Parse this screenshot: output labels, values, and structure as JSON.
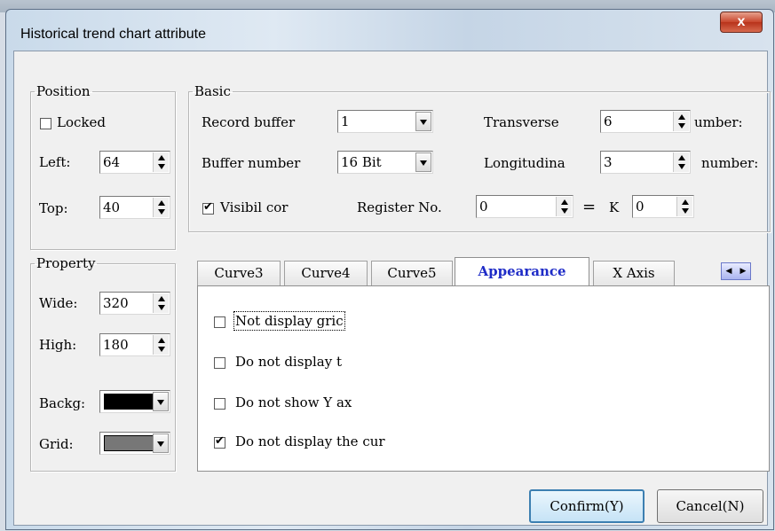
{
  "window": {
    "title": "Historical trend chart attribute",
    "close_label": "x"
  },
  "position": {
    "legend": "Position",
    "locked_label": "Locked",
    "locked_checked": false,
    "left_label": "Left:",
    "left_value": "64",
    "top_label": "Top:",
    "top_value": "40"
  },
  "basic": {
    "legend": "Basic",
    "record_buffer_label": "Record buffer",
    "record_buffer_value": "1",
    "buffer_number_label": "Buffer number",
    "buffer_number_value": "16 Bit",
    "transverse_label": "Transverse",
    "transverse_value": "6",
    "transverse_suffix": "umber:",
    "longitudinal_label": "Longitudina",
    "longitudinal_value": "3",
    "longitudinal_suffix": "number:",
    "visibility_label": "Visibil cor",
    "visibility_checked": true,
    "register_label": "Register No.",
    "register_value": "0",
    "equals": "=",
    "k_label": "K",
    "k_value": "0"
  },
  "property": {
    "legend": "Property",
    "wide_label": "Wide:",
    "wide_value": "320",
    "high_label": "High:",
    "high_value": "180",
    "backg_label": "Backg:",
    "backg_color": "#000000",
    "grid_label": "Grid:",
    "grid_color": "#777777"
  },
  "tabs": [
    {
      "label": "Curve3"
    },
    {
      "label": "Curve4"
    },
    {
      "label": "Curve5"
    },
    {
      "label": "Appearance",
      "active": true
    },
    {
      "label": "X Axis"
    }
  ],
  "appearance": {
    "options": [
      {
        "label": "Not display gric",
        "checked": false
      },
      {
        "label": "Do not display t",
        "checked": false
      },
      {
        "label": "Do not show Y ax",
        "checked": false
      },
      {
        "label": "Do not display the cur",
        "checked": true
      }
    ]
  },
  "buttons": {
    "confirm": "Confirm(Y)",
    "cancel": "Cancel(N)"
  }
}
